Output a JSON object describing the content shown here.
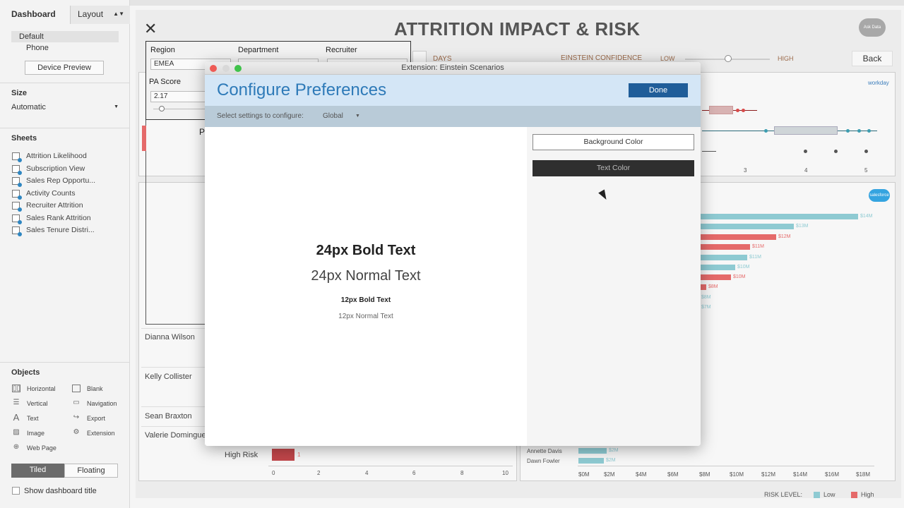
{
  "left_pane": {
    "tabs": [
      {
        "label": "Dashboard"
      },
      {
        "label": "Layout"
      }
    ],
    "device": {
      "items": [
        "Default",
        "Phone"
      ],
      "preview_button": "Device Preview"
    },
    "size": {
      "heading": "Size",
      "value": "Automatic"
    },
    "sheets": {
      "heading": "Sheets",
      "items": [
        "Attrition Likelihood",
        "Subscription View",
        "Sales Rep Opportu...",
        "Activity Counts",
        "Recruiter Attrition",
        "Sales Rank Attrition",
        "Sales Tenure Distri..."
      ]
    },
    "objects": {
      "heading": "Objects",
      "items": [
        {
          "label": "Horizontal",
          "icon": "horizontal-icon"
        },
        {
          "label": "Blank",
          "icon": "blank-icon"
        },
        {
          "label": "Vertical",
          "icon": "vertical-icon"
        },
        {
          "label": "Navigation",
          "icon": "navigation-icon"
        },
        {
          "label": "Text",
          "icon": "text-icon"
        },
        {
          "label": "Export",
          "icon": "export-icon"
        },
        {
          "label": "Image",
          "icon": "image-icon"
        },
        {
          "label": "Extension",
          "icon": "extension-icon"
        },
        {
          "label": "Web Page",
          "icon": "web-page-icon"
        }
      ]
    },
    "layout_mode": {
      "tiled": "Tiled",
      "floating": "Floating"
    },
    "show_title": "Show dashboard title"
  },
  "dashboard": {
    "title": "ATTRITION IMPACT & RISK",
    "ask_data": "Ask Data",
    "filters": {
      "region_label": "Region",
      "region_value": "EMEA",
      "department_label": "Department",
      "recruiter_label": "Recruiter",
      "pa_score_label": "PA Score",
      "pa_score_value": "2.17",
      "p_label": "P"
    },
    "days_label": "DAYS",
    "einstein_confidence": "EINSTEIN CONFIDENCE",
    "low": "LOW",
    "high": "HIGH",
    "back_button": "Back",
    "workday_logo": "workday",
    "salesforce_logo": "salesforce",
    "box_axis": [
      "3",
      "4",
      "5"
    ],
    "bar_labels": [
      "$14M",
      "$13M",
      "$12M",
      "$11M",
      "$11M",
      "$10M",
      "$10M",
      "$8M",
      "$8M",
      "$7M"
    ],
    "names": [
      "Dianna Wilson",
      "Kelly Collister",
      "Sean Braxton",
      "Valerie Domingue"
    ],
    "high_risk_label": "High Risk",
    "high_risk_value": "1",
    "left_axis": [
      "0",
      "2",
      "4",
      "6",
      "8",
      "10"
    ],
    "bottom_names": [
      "Annette Davis",
      "Dawn Fowler"
    ],
    "bottom_values": [
      "$2M",
      "$2M"
    ],
    "right_axis": [
      "$0M",
      "$2M",
      "$4M",
      "$6M",
      "$8M",
      "$10M",
      "$12M",
      "$14M",
      "$16M",
      "$18M"
    ],
    "risk_level": "RISK LEVEL:",
    "risk_low": "Low",
    "risk_high": "High",
    "colors": {
      "low": "#8ecad2",
      "high": "#e56a6a"
    }
  },
  "modal": {
    "window_title": "Extension: Einstein Scenarios",
    "title": "Configure Preferences",
    "done": "Done",
    "settings_label": "Select settings to configure:",
    "settings_value": "Global",
    "preview": [
      "24px Bold Text",
      "24px Normal Text",
      "12px Bold Text",
      "12px Normal Text"
    ],
    "background_color": "Background Color",
    "text_color": "Text Color",
    "accent": "#2e7ab8"
  }
}
